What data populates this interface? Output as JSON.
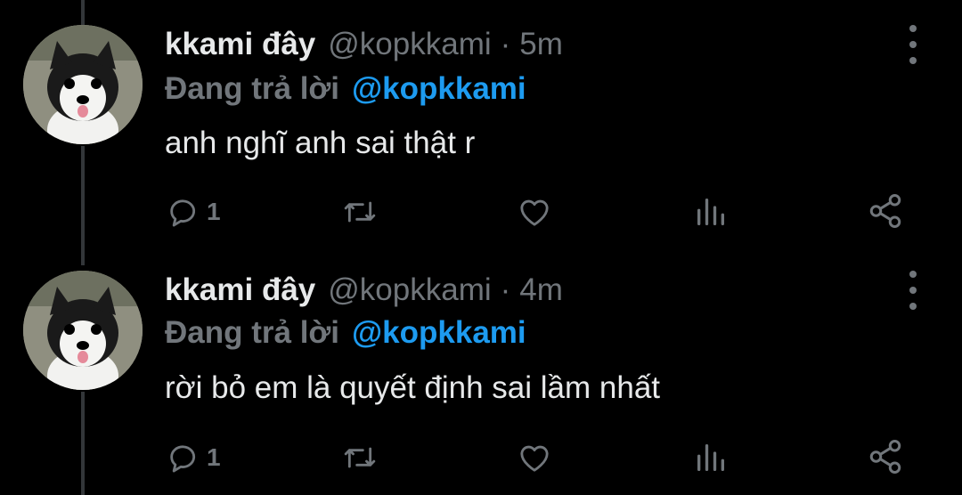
{
  "tweets": [
    {
      "name": "kkami đây",
      "handle": "@kopkkami",
      "separator": "·",
      "time": "5m",
      "reply_prefix": "Đang trả lời",
      "reply_to": "@kopkkami",
      "text": "anh nghĩ anh sai thật r",
      "reply_count": "1",
      "avatar": "dog-avatar"
    },
    {
      "name": "kkami đây",
      "handle": "@kopkkami",
      "separator": "·",
      "time": "4m",
      "reply_prefix": "Đang trả lời",
      "reply_to": "@kopkkami",
      "text": "rời bỏ em là quyết định sai lầm nhất",
      "reply_count": "1",
      "avatar": "dog-avatar"
    }
  ],
  "icons": [
    "reply-icon",
    "retweet-icon",
    "like-icon",
    "analytics-icon",
    "share-icon",
    "more-options-icon"
  ],
  "colors": {
    "background": "#000000",
    "text": "#e7e9ea",
    "muted": "#71767b",
    "accent": "#1d9bf0",
    "thread_line": "#333639"
  }
}
